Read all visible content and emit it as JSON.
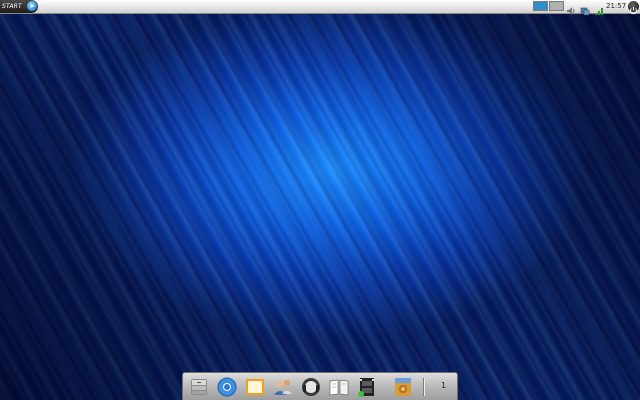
{
  "top_panel": {
    "start_label": "START",
    "start_icon": "start-arrow-icon",
    "workspaces": [
      {
        "name": "workspace-1",
        "active": true,
        "color": "#2f8ec8"
      },
      {
        "name": "workspace-2",
        "active": false,
        "color": "#b0b0b0"
      }
    ],
    "tray": [
      "volume-icon",
      "network-icon",
      "wifi-icon"
    ],
    "clock": "21:57",
    "power_icon": "power-icon"
  },
  "dock": {
    "items": [
      {
        "name": "file-manager-icon"
      },
      {
        "name": "chromium-browser-icon"
      },
      {
        "name": "notes-icon"
      },
      {
        "name": "contacts-icon"
      },
      {
        "name": "music-player-icon"
      },
      {
        "name": "ebook-reader-icon"
      },
      {
        "name": "video-editor-icon"
      },
      {
        "name": "archive-manager-icon"
      }
    ],
    "desktop_number": "1"
  },
  "colors": {
    "wallpaper_center": "#1a8cff",
    "wallpaper_edge": "#041a5c"
  }
}
